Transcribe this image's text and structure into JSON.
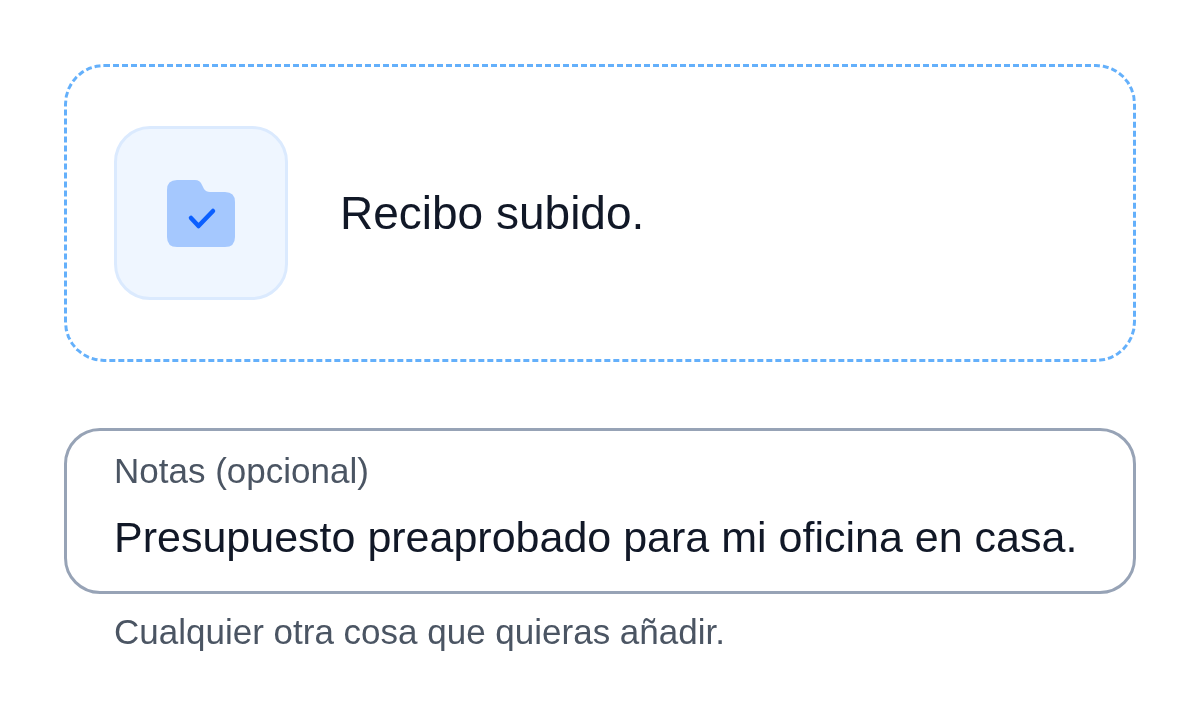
{
  "upload": {
    "status": "Recibo subido."
  },
  "notes": {
    "label": "Notas (opcional)",
    "value": "Presupuesto preaprobado para mi oficina en casa.",
    "helper": "Cualquier otra cosa que quieras añadir."
  }
}
